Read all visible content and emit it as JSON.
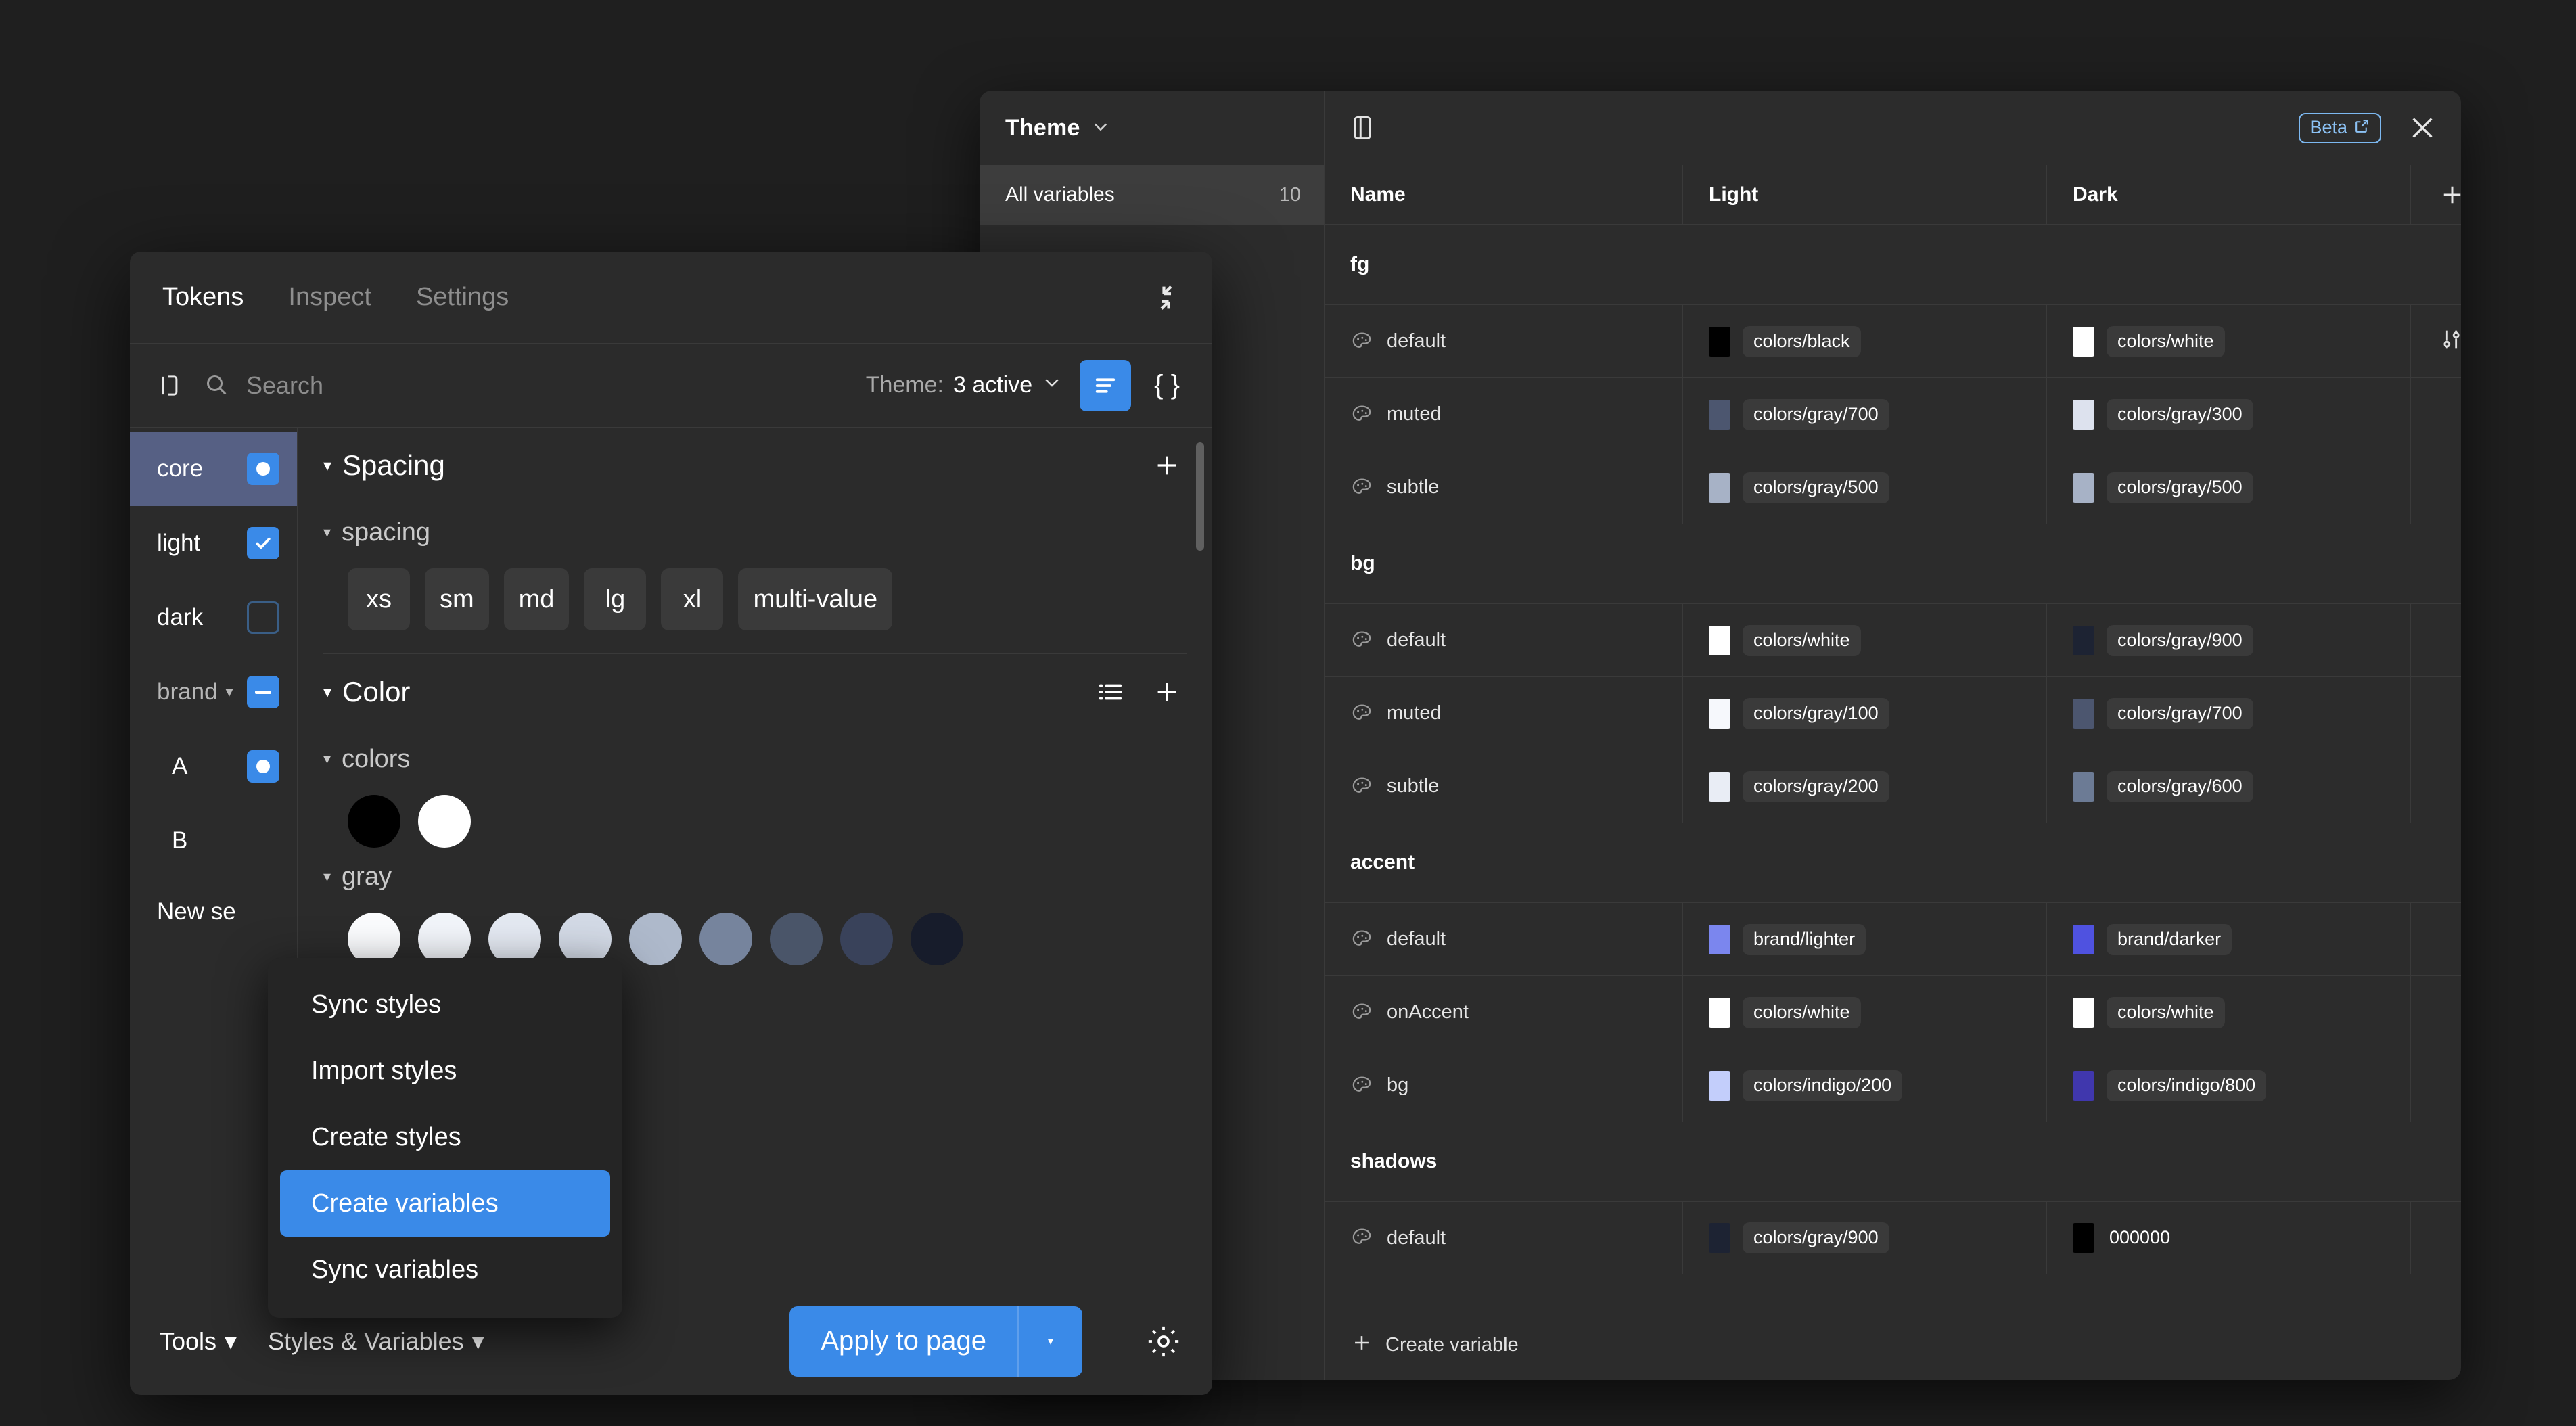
{
  "variables_modal": {
    "theme_selector_label": "Theme",
    "chevron_icon": "chevron-down-icon",
    "panel_toggle_icon": "panel-layout-icon",
    "beta_badge_label": "Beta",
    "beta_external_icon": "external-link-icon",
    "close_icon": "close-icon",
    "collection": {
      "label": "All variables",
      "count": "10"
    },
    "columns": {
      "name": "Name",
      "light": "Light",
      "dark": "Dark",
      "add": "+"
    },
    "groups": [
      {
        "name": "fg",
        "rows": [
          {
            "name": "default",
            "light": {
              "value": "colors/black",
              "color": "#000000"
            },
            "dark": {
              "value": "colors/white",
              "color": "#ffffff"
            },
            "has_actions": true
          },
          {
            "name": "muted",
            "light": {
              "value": "colors/gray/700",
              "color": "#4c566f"
            },
            "dark": {
              "value": "colors/gray/300",
              "color": "#dde2ee"
            },
            "has_actions": false
          },
          {
            "name": "subtle",
            "light": {
              "value": "colors/gray/500",
              "color": "#a7b2c6"
            },
            "dark": {
              "value": "colors/gray/500",
              "color": "#a7b2c6"
            },
            "has_actions": false
          }
        ]
      },
      {
        "name": "bg",
        "rows": [
          {
            "name": "default",
            "light": {
              "value": "colors/white",
              "color": "#ffffff"
            },
            "dark": {
              "value": "colors/gray/900",
              "color": "#1d2333"
            },
            "has_actions": false
          },
          {
            "name": "muted",
            "light": {
              "value": "colors/gray/100",
              "color": "#f6f8fc"
            },
            "dark": {
              "value": "colors/gray/700",
              "color": "#4c566f"
            },
            "has_actions": false
          },
          {
            "name": "subtle",
            "light": {
              "value": "colors/gray/200",
              "color": "#e9edf5"
            },
            "dark": {
              "value": "colors/gray/600",
              "color": "#6c7b95"
            },
            "has_actions": false
          }
        ]
      },
      {
        "name": "accent",
        "rows": [
          {
            "name": "default",
            "light": {
              "value": "brand/lighter",
              "color": "#7b86ee"
            },
            "dark": {
              "value": "brand/darker",
              "color": "#4f52e0"
            },
            "has_actions": false
          },
          {
            "name": "onAccent",
            "light": {
              "value": "colors/white",
              "color": "#ffffff"
            },
            "dark": {
              "value": "colors/white",
              "color": "#ffffff"
            },
            "has_actions": false
          },
          {
            "name": "bg",
            "light": {
              "value": "colors/indigo/200",
              "color": "#c3cefb"
            },
            "dark": {
              "value": "colors/indigo/800",
              "color": "#4037ad"
            },
            "has_actions": false
          }
        ]
      },
      {
        "name": "shadows",
        "rows": [
          {
            "name": "default",
            "light": {
              "value": "colors/gray/900",
              "color": "#1d2333"
            },
            "dark": {
              "value": "000000",
              "color": "#000000",
              "plain": true
            },
            "has_actions": false
          }
        ]
      }
    ],
    "footer": {
      "create_variable_label": "Create variable",
      "plus_icon": "plus-icon"
    }
  },
  "plugin": {
    "tabs": [
      {
        "label": "Tokens",
        "active": true
      },
      {
        "label": "Inspect",
        "active": false
      },
      {
        "label": "Settings",
        "active": false
      }
    ],
    "collapse_icon": "collapse-diagonal-icon",
    "toolbar": {
      "sidebar_toggle_icon": "panel-left-icon",
      "search_icon": "search-icon",
      "search_value": "",
      "search_placeholder": "Search",
      "theme_label": "Theme:",
      "theme_value": "3 active",
      "theme_chevron_icon": "chevron-down-icon",
      "list_view_icon": "list-view-icon",
      "json_view_icon": "json-braces-icon"
    },
    "token_sets": [
      {
        "label": "core",
        "state": "partial-dot",
        "selected": true,
        "child": false,
        "has_caret": false
      },
      {
        "label": "light",
        "state": "checked",
        "selected": false,
        "child": false,
        "has_caret": false
      },
      {
        "label": "dark",
        "state": "unchecked",
        "selected": false,
        "child": false,
        "has_caret": false
      },
      {
        "label": "brand",
        "state": "indeterminate",
        "selected": false,
        "child": false,
        "has_caret": true
      },
      {
        "label": "A",
        "state": "partial-dot",
        "selected": false,
        "child": true,
        "has_caret": false
      },
      {
        "label": "B",
        "state": "none",
        "selected": false,
        "child": true,
        "has_caret": false
      }
    ],
    "new_set_label": "New se",
    "sections": [
      {
        "title": "Spacing",
        "caret_icon": "caret-down-icon",
        "add_icon": "plus-icon",
        "has_list_icon": false,
        "group": {
          "title": "spacing",
          "caret_icon": "caret-down-icon",
          "tokens": [
            "xs",
            "sm",
            "md",
            "lg",
            "xl",
            "multi-value"
          ]
        }
      },
      {
        "title": "Color",
        "caret_icon": "caret-down-icon",
        "add_icon": "plus-icon",
        "has_list_icon": true,
        "list_icon": "list-view-icon",
        "groups": [
          {
            "title": "colors",
            "caret_icon": "caret-down-icon",
            "colors": [
              "#000000",
              "#ffffff"
            ]
          },
          {
            "title": "gray",
            "caret_icon": "caret-down-icon",
            "colors": [
              "#fbfcfe",
              "#f2f5fa",
              "#e4e9f2",
              "#d3dae6",
              "#aeb9cb",
              "#76849d",
              "#4a5569",
              "#39425a",
              "#171c2b"
            ]
          }
        ]
      }
    ],
    "footer": {
      "tools_label": "Tools",
      "styles_variables_label": "Styles & Variables",
      "apply_label": "Apply to page",
      "apply_caret_icon": "caret-down-icon",
      "settings_icon": "gear-icon"
    }
  },
  "context_menu": {
    "items": [
      {
        "label": "Sync styles",
        "active": false
      },
      {
        "label": "Import styles",
        "active": false
      },
      {
        "label": "Create styles",
        "active": false
      },
      {
        "label": "Create variables",
        "active": true
      },
      {
        "label": "Sync variables",
        "active": false
      }
    ]
  }
}
